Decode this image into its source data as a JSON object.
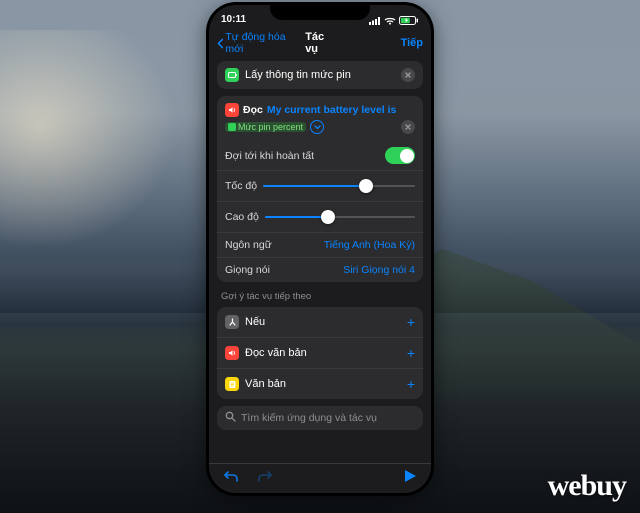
{
  "statusbar": {
    "time": "10:11",
    "battery_pct": 62
  },
  "nav": {
    "back_label": "Tự động hóa mới",
    "title": "Tác vụ",
    "next": "Tiếp"
  },
  "action_battery": {
    "title": "Lấy thông tin mức pin"
  },
  "action_speak": {
    "label": "Đọc",
    "text_prefix": "My current battery level is",
    "variable": "Mức pin percent",
    "options": {
      "wait_label": "Đợi tới khi hoàn tất",
      "wait_on": true,
      "rate_label": "Tốc độ",
      "rate_value": 0.68,
      "pitch_label": "Cao độ",
      "pitch_value": 0.42,
      "language_label": "Ngôn ngữ",
      "language_value": "Tiếng Anh (Hoa Kỳ)",
      "voice_label": "Giọng nói",
      "voice_value": "Siri Giọng nói 4"
    }
  },
  "suggestions": {
    "header": "Gợi ý tác vụ tiếp theo",
    "items": [
      {
        "icon": "gray",
        "glyph": "branch",
        "title": "Nếu"
      },
      {
        "icon": "red",
        "glyph": "speaker",
        "title": "Đọc văn bản"
      },
      {
        "icon": "yellow",
        "glyph": "note",
        "title": "Văn bản"
      }
    ]
  },
  "search": {
    "placeholder": "Tìm kiếm ứng dụng và tác vụ"
  },
  "watermark": "webuy"
}
